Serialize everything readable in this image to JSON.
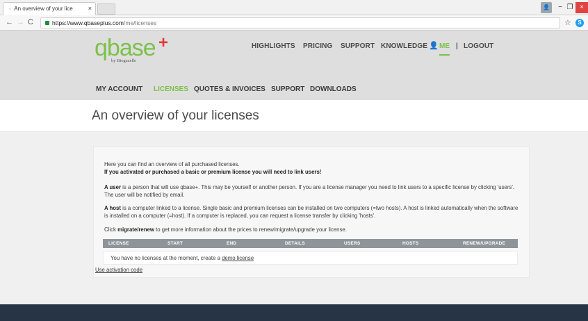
{
  "browser": {
    "tab_title": "An overview of your lice",
    "tab_favicon": "◦",
    "tab_close": "×",
    "url_host": "https://www.qbaseplus.com",
    "url_path": "/me/licenses",
    "back": "←",
    "forward": "→",
    "reload": "C",
    "bookmark": "☆",
    "extension": "S",
    "win_user": "👤",
    "win_min": "−",
    "win_max": "❐",
    "win_close": "×"
  },
  "brand": {
    "logo": "qbase",
    "logo_plus": "+",
    "sub": "by Biogazelle"
  },
  "top_nav": {
    "highlights": "HIGHLIGHTS",
    "pricing": "PRICING",
    "support": "SUPPORT",
    "knowledge": "KNOWLEDGE",
    "user_icon": "👤",
    "me": "ME",
    "separator": "|",
    "logout": "LOGOUT"
  },
  "sub_nav": {
    "my_account": "MY ACCOUNT",
    "licenses": "LICENSES",
    "quotes": "QUOTES & INVOICES",
    "support": "SUPPORT",
    "downloads": "DOWNLOADS"
  },
  "page": {
    "title": "An overview of your licenses"
  },
  "content": {
    "intro": "Here you can find an overview of all purchased licenses.",
    "intro_bold": "If you activated or purchased a basic or premium license you will need to link users!",
    "user_term": "A user",
    "user_text": " is a person that will use qbase+. This may be yourself or another person. If you are a license manager you need to link users to a specific license by clicking 'users'. The user will be notified by email.",
    "host_term": "A host",
    "host_text": " is a computer linked to a license. Single basic and premium licenses can be installed on two computers (=two hosts). A host is linked automatically when the software is installed on a computer (=host). If a computer is replaced, you can request a license transfer by clicking 'hosts'.",
    "click_pre": "Click ",
    "click_term": "migrate/renew",
    "click_post": " to get more information about the prices to renew/migrate/upgrade your license."
  },
  "table": {
    "headers": [
      "LICENSE",
      "START",
      "END",
      "DETAILS",
      "USERS",
      "HOSTS",
      "RENEW/UPGRADE"
    ],
    "empty_text": "You have no licenses at the moment, create a ",
    "demo_link": "demo license"
  },
  "activation_link": "Use activation code"
}
